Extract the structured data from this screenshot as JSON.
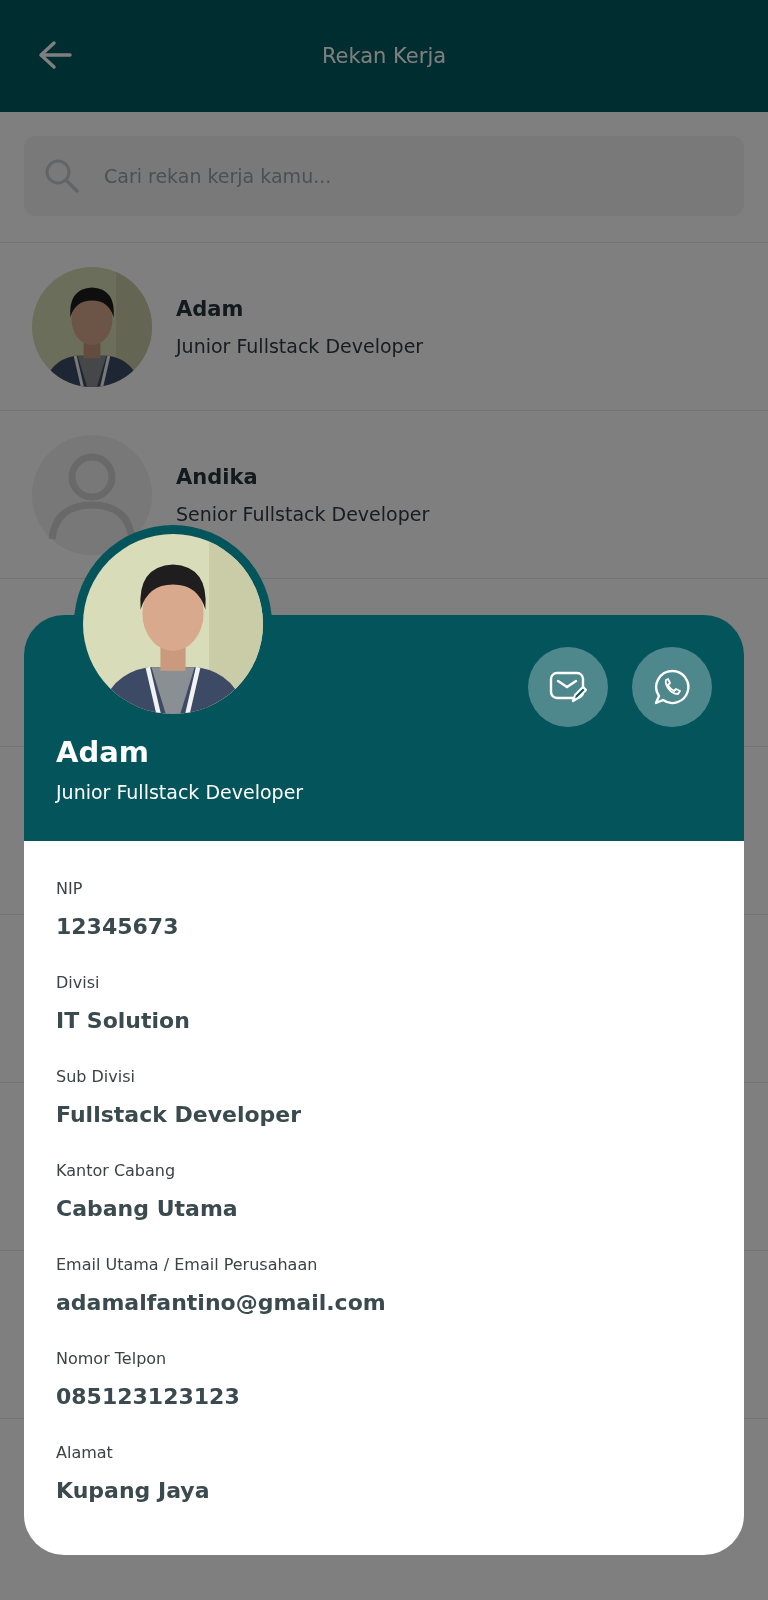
{
  "header": {
    "title": "Rekan Kerja"
  },
  "search": {
    "placeholder": "Cari rekan kerja kamu..."
  },
  "colleagues": [
    {
      "name": "Adam",
      "position": "Junior Fullstack Developer",
      "kind": "picture"
    },
    {
      "name": "Andika",
      "position": "Senior Fullstack Developer",
      "kind": "placeholder"
    }
  ],
  "detail": {
    "name": "Adam",
    "position": "Junior Fullstack Developer",
    "fields": [
      {
        "label": "NIP",
        "value": "12345673"
      },
      {
        "label": "Divisi",
        "value": "IT Solution"
      },
      {
        "label": "Sub Divisi",
        "value": "Fullstack Developer"
      },
      {
        "label": "Kantor Cabang",
        "value": "Cabang Utama"
      },
      {
        "label": "Email Utama / Email Perusahaan",
        "value": "adamalfantino@gmail.com"
      },
      {
        "label": "Nomor Telpon",
        "value": "085123123123"
      },
      {
        "label": "Alamat",
        "value": "Kupang Jaya"
      }
    ]
  }
}
